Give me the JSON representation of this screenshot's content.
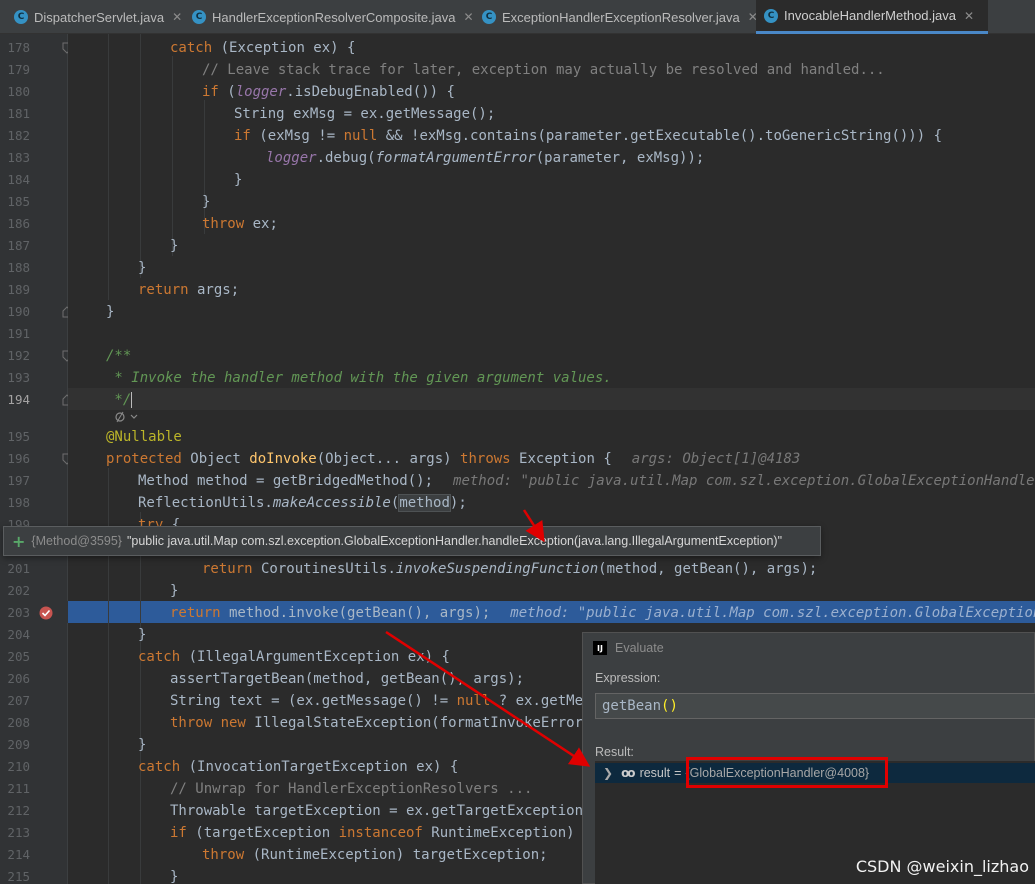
{
  "tabs": [
    {
      "name": "DispatcherServlet.java",
      "icon": "C",
      "active": false
    },
    {
      "name": "HandlerExceptionResolverComposite.java",
      "icon": "C",
      "active": false
    },
    {
      "name": "ExceptionHandlerExceptionResolver.java",
      "icon": "C",
      "active": false
    },
    {
      "name": "InvocableHandlerMethod.java",
      "icon": "C",
      "active": true
    }
  ],
  "line_numbers": [
    "178",
    "179",
    "180",
    "181",
    "182",
    "183",
    "184",
    "185",
    "186",
    "187",
    "188",
    "189",
    "190",
    "191",
    "192",
    "193",
    "194",
    "195",
    "196",
    "197",
    "198",
    "199",
    "201",
    "202",
    "203",
    "204",
    "205",
    "206",
    "207",
    "208",
    "209",
    "210",
    "211",
    "212",
    "213",
    "214",
    "215"
  ],
  "code": {
    "l178": [
      "catch",
      " (Exception ex) {"
    ],
    "l179": "// Leave stack trace for later, exception may actually be resolved and handled...",
    "l180": [
      "if",
      " (",
      "logger",
      ".isDebugEnabled()) {"
    ],
    "l181": "String exMsg = ex.getMessage();",
    "l182": [
      "if",
      " (exMsg != ",
      "null",
      " && !exMsg.contains(parameter.getExecutable().toGenericString())) {"
    ],
    "l183": [
      "logger",
      ".debug(",
      "formatArgumentError",
      "(parameter, exMsg));"
    ],
    "l184": "}",
    "l185": "}",
    "l186": [
      "throw",
      " ex;"
    ],
    "l187": "}",
    "l188": "}",
    "l189": [
      "return",
      " args;"
    ],
    "l190": "}",
    "l192": "/**",
    "l193": " * Invoke the handler method with the given argument values.",
    "l194": " */",
    "l195": "@Nullable",
    "l196": [
      "protected",
      " Object ",
      "doInvoke",
      "(Object... args) ",
      "throws",
      " Exception {",
      "args: Object[1]@4183"
    ],
    "l197": [
      "Method method = getBridgedMethod();",
      "method: \"public java.util.Map com.szl.exception.GlobalExceptionHandler.hand"
    ],
    "l198": [
      "ReflectionUtils.",
      "makeAccessible",
      "(",
      "method",
      ");"
    ],
    "l199": [
      "try",
      " {"
    ],
    "l201": [
      "return",
      " CoroutinesUtils.",
      "invokeSuspendingFunction",
      "(method, getBean(), args);"
    ],
    "l202": "}",
    "l203": [
      "return",
      " method.invoke(getBean(), args);",
      "method: \"public java.util.Map com.szl.exception.GlobalExceptionHandl"
    ],
    "l204": "}",
    "l205": [
      "catch",
      " (IllegalArgumentException ex) {"
    ],
    "l206": "assertTargetBean(method, getBean(), args);",
    "l207": [
      "String text = (ex.getMessage() != ",
      "null",
      " ? ex.getMessa"
    ],
    "l208": [
      "throw new",
      " IllegalStateException(formatInvokeError(te"
    ],
    "l209": "}",
    "l210": [
      "catch",
      " (InvocationTargetException ex) {"
    ],
    "l211": "// Unwrap for HandlerExceptionResolvers ...",
    "l212": "Throwable targetException = ex.getTargetException();",
    "l213": [
      "if",
      " (targetException ",
      "instanceof",
      " RuntimeException) {"
    ],
    "l214": [
      "throw",
      " (RuntimeException) targetException;"
    ],
    "l215": "}"
  },
  "tooltip": {
    "plus": "+",
    "type": "{Method@3595}",
    "value": "\"public java.util.Map com.szl.exception.GlobalExceptionHandler.handleException(java.lang.IllegalArgumentException)\""
  },
  "evaluate": {
    "title": "Evaluate",
    "expression_label": "Expression:",
    "expression_text": "getBean",
    "expression_parens": "()",
    "result_label": "Result:",
    "result_name": "result",
    "result_eq": "=",
    "result_value": "{GlobalExceptionHandler@4008}"
  },
  "watermark": "CSDN @weixin_lizhao",
  "colors": {
    "keyword": "#cc7832",
    "comment": "#808080",
    "doc_comment": "#629755",
    "annotation": "#bbb529",
    "field": "#9876aa",
    "method_decl": "#ffc66d",
    "breakpoint_line": "#2d5b9a",
    "annotation_red": "#e00000"
  },
  "icons": [
    "class-icon",
    "close-icon",
    "bulb-icon",
    "breakpoint-icon",
    "fold-icon",
    "intellij-icon",
    "chevron-right-icon",
    "watch-glasses-icon"
  ]
}
